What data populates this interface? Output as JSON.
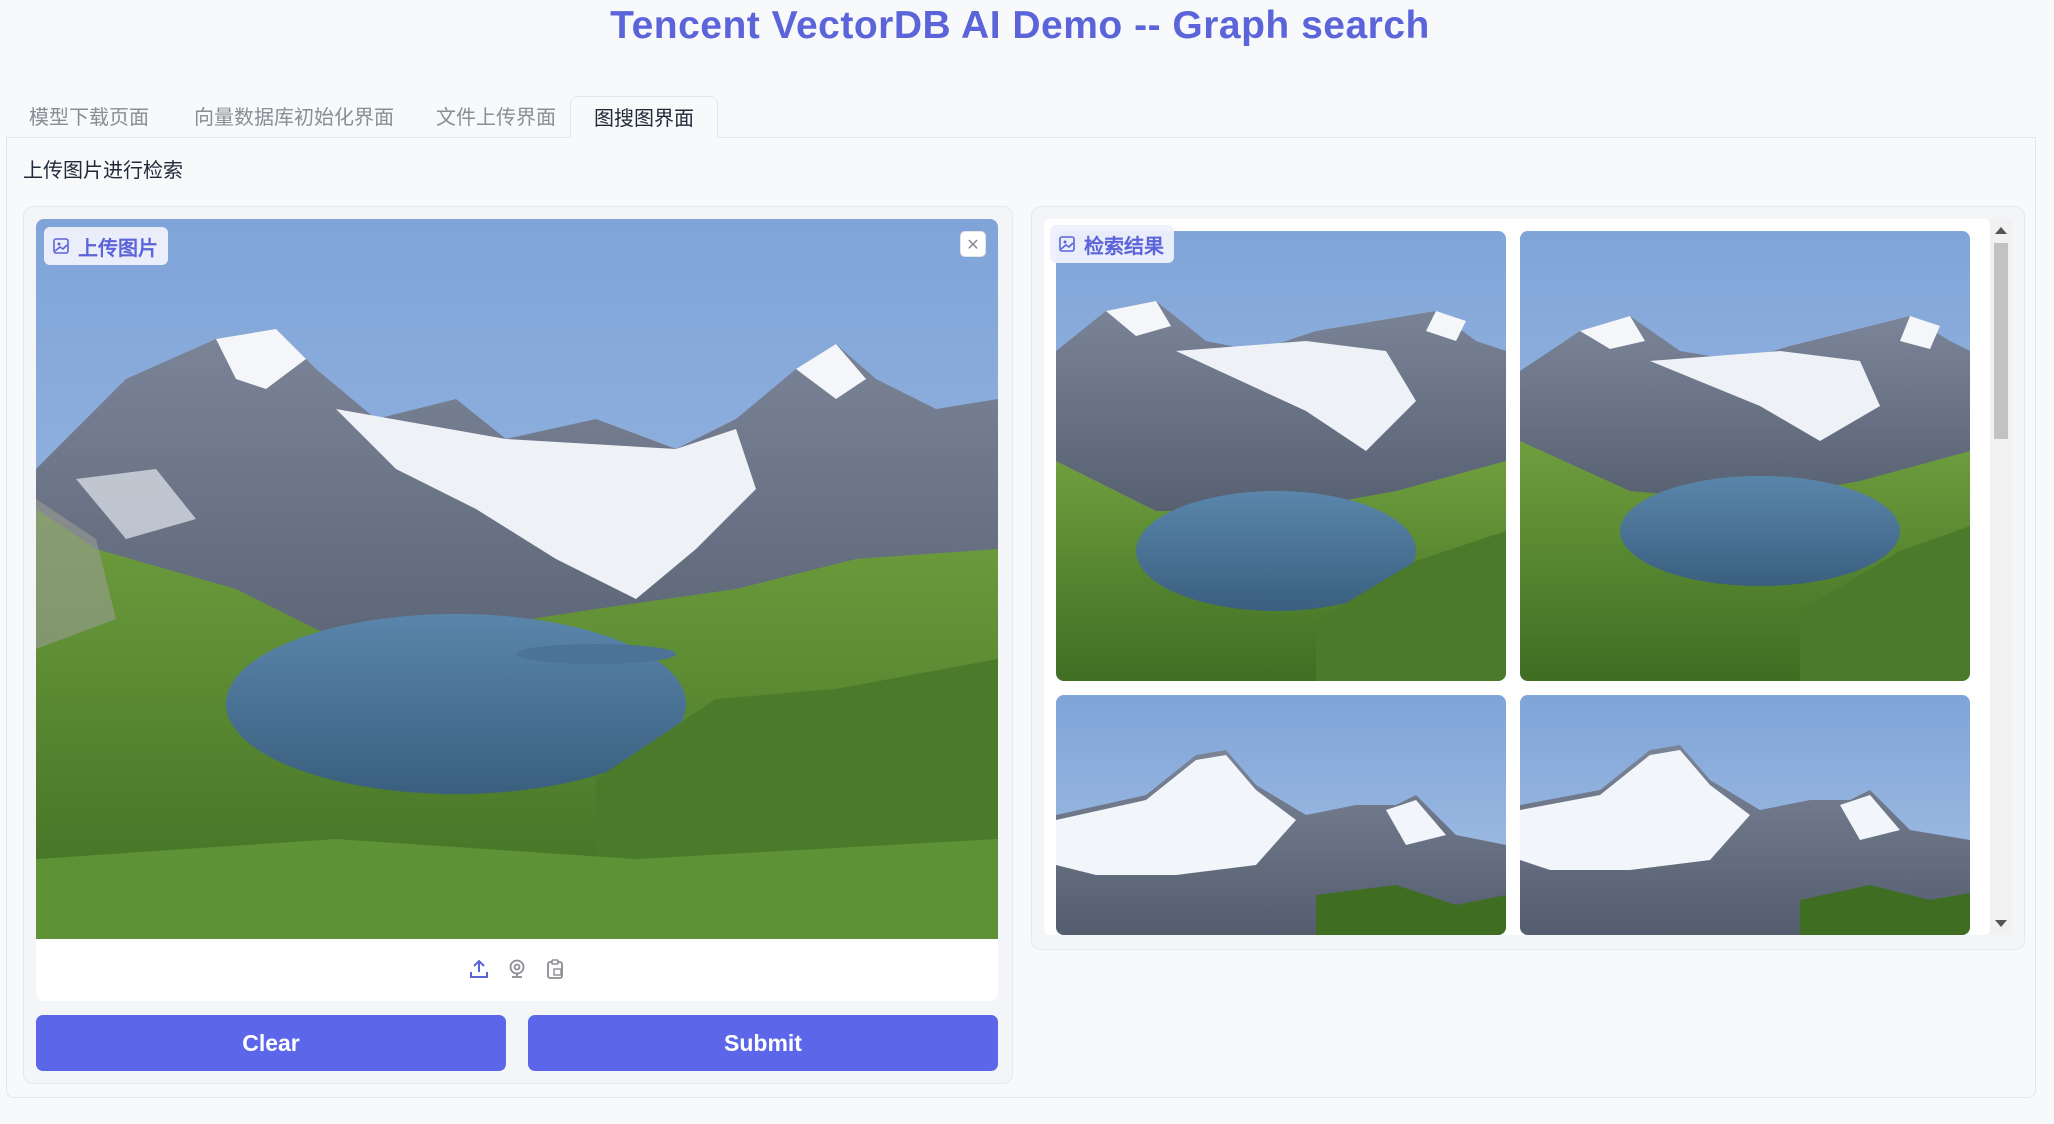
{
  "app": {
    "title": "Tencent VectorDB AI Demo -- Graph search"
  },
  "tabs": [
    {
      "label": "模型下载页面",
      "active": false
    },
    {
      "label": "向量数据库初始化界面",
      "active": false
    },
    {
      "label": "文件上传界面",
      "active": false
    },
    {
      "label": "图搜图界面",
      "active": true
    }
  ],
  "section": {
    "label": "上传图片进行检索"
  },
  "upload": {
    "badge_label": "上传图片",
    "badge_icon": "image-icon",
    "close_icon": "close-icon",
    "tool_icons": [
      "upload-icon",
      "webcam-icon",
      "clipboard-icon"
    ]
  },
  "results": {
    "badge_label": "检索结果",
    "badge_icon": "image-icon",
    "items": [
      {
        "scene": "mountain-lake"
      },
      {
        "scene": "mountain-lake"
      },
      {
        "scene": "snow-peaks"
      },
      {
        "scene": "snow-peaks"
      }
    ]
  },
  "buttons": {
    "clear_label": "Clear",
    "submit_label": "Submit"
  },
  "colors": {
    "accent": "#5b64d9",
    "button": "#5b67e8",
    "sky": "#8bb0df",
    "grass": "#5c8f34",
    "lake": "#4a7397"
  }
}
